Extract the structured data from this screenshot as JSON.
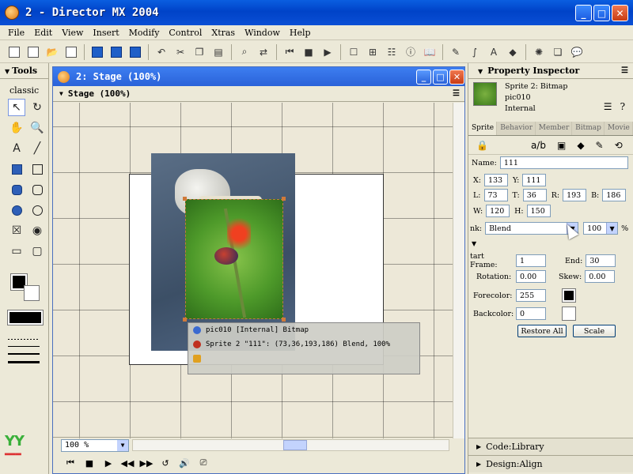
{
  "window": {
    "title": "2 - Director MX 2004",
    "controls": [
      "_",
      "□",
      "✕"
    ]
  },
  "menu": [
    "File",
    "Edit",
    "View",
    "Insert",
    "Modify",
    "Control",
    "Xtras",
    "Window",
    "Help"
  ],
  "tools": {
    "header": "Tools",
    "mode": "classic",
    "logo_text": "YY"
  },
  "stage": {
    "window_title": "2: Stage (100%)",
    "panel_title": "Stage (100%)",
    "zoom": "100 %",
    "tooltip": {
      "line1": "pic010 [Internal] Bitmap",
      "line2": "Sprite 2 \"111\": (73,36,193,186) Blend, 100%"
    }
  },
  "inspector": {
    "header": "Property Inspector",
    "sprite_line": "Sprite 2: Bitmap",
    "member_name": "pic010",
    "member_cast": "Internal",
    "tabs": [
      "Sprite",
      "Behavior",
      "Member",
      "Bitmap",
      "Movie"
    ],
    "name_label": "Name:",
    "name_value": "111",
    "x_label": "X:",
    "x_value": "133",
    "y_label": "Y:",
    "y_value": "111",
    "l_label": "L:",
    "l_value": "73",
    "t_label": "T:",
    "t_value": "36",
    "r_label": "R:",
    "r_value": "193",
    "b_label": "B:",
    "b_value": "186",
    "w_label": "W:",
    "w_value": "120",
    "h_label": "H:",
    "h_value": "150",
    "ink_label": "nk:",
    "ink_value": "Blend",
    "blend_value": "100",
    "blend_unit": "%",
    "start_frame_label": "tart Frame:",
    "start_frame_value": "1",
    "end_label": "End:",
    "end_value": "30",
    "rotation_label": "Rotation:",
    "rotation_value": "0.00",
    "skew_label": "Skew:",
    "skew_value": "0.00",
    "forecolor_label": "Forecolor:",
    "forecolor_value": "255",
    "backcolor_label": "Backcolor:",
    "backcolor_value": "0",
    "restore_all": "Restore All",
    "scale": "Scale",
    "code_library": "Code:Library",
    "design_align": "Design:Align"
  },
  "colors": {
    "title_blue": "#0043c8",
    "accent_close": "#c83c14",
    "panel_bg": "#ece9d8"
  }
}
